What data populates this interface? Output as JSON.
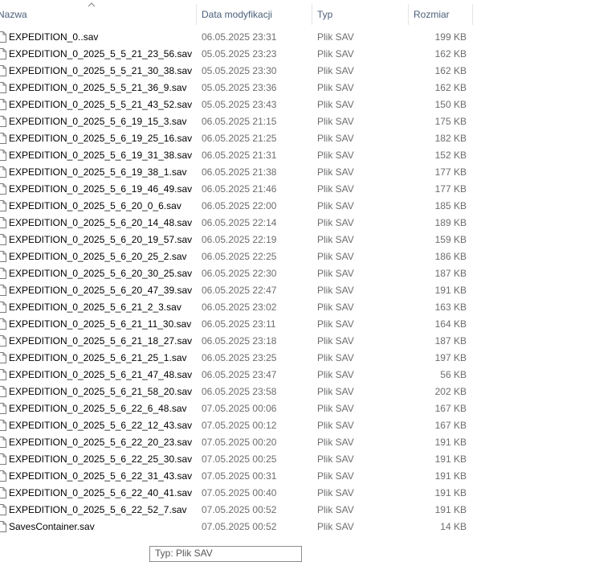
{
  "columns": {
    "name": "Nazwa",
    "date": "Data modyfikacji",
    "type": "Typ",
    "size": "Rozmiar"
  },
  "icons": {
    "sort": "sort-ascending-chevron-icon",
    "file": "file-icon"
  },
  "files": [
    {
      "name": "EXPEDITION_0..sav",
      "date": "06.05.2025 23:31",
      "type": "Plik SAV",
      "size": "199 KB"
    },
    {
      "name": "EXPEDITION_0_2025_5_5_21_23_56.sav",
      "date": "05.05.2025 23:23",
      "type": "Plik SAV",
      "size": "162 KB"
    },
    {
      "name": "EXPEDITION_0_2025_5_5_21_30_38.sav",
      "date": "05.05.2025 23:30",
      "type": "Plik SAV",
      "size": "162 KB"
    },
    {
      "name": "EXPEDITION_0_2025_5_5_21_36_9.sav",
      "date": "05.05.2025 23:36",
      "type": "Plik SAV",
      "size": "162 KB"
    },
    {
      "name": "EXPEDITION_0_2025_5_5_21_43_52.sav",
      "date": "05.05.2025 23:43",
      "type": "Plik SAV",
      "size": "150 KB"
    },
    {
      "name": "EXPEDITION_0_2025_5_6_19_15_3.sav",
      "date": "06.05.2025 21:15",
      "type": "Plik SAV",
      "size": "175 KB"
    },
    {
      "name": "EXPEDITION_0_2025_5_6_19_25_16.sav",
      "date": "06.05.2025 21:25",
      "type": "Plik SAV",
      "size": "182 KB"
    },
    {
      "name": "EXPEDITION_0_2025_5_6_19_31_38.sav",
      "date": "06.05.2025 21:31",
      "type": "Plik SAV",
      "size": "152 KB"
    },
    {
      "name": "EXPEDITION_0_2025_5_6_19_38_1.sav",
      "date": "06.05.2025 21:38",
      "type": "Plik SAV",
      "size": "177 KB"
    },
    {
      "name": "EXPEDITION_0_2025_5_6_19_46_49.sav",
      "date": "06.05.2025 21:46",
      "type": "Plik SAV",
      "size": "177 KB"
    },
    {
      "name": "EXPEDITION_0_2025_5_6_20_0_6.sav",
      "date": "06.05.2025 22:00",
      "type": "Plik SAV",
      "size": "185 KB"
    },
    {
      "name": "EXPEDITION_0_2025_5_6_20_14_48.sav",
      "date": "06.05.2025 22:14",
      "type": "Plik SAV",
      "size": "189 KB"
    },
    {
      "name": "EXPEDITION_0_2025_5_6_20_19_57.sav",
      "date": "06.05.2025 22:19",
      "type": "Plik SAV",
      "size": "159 KB"
    },
    {
      "name": "EXPEDITION_0_2025_5_6_20_25_2.sav",
      "date": "06.05.2025 22:25",
      "type": "Plik SAV",
      "size": "186 KB"
    },
    {
      "name": "EXPEDITION_0_2025_5_6_20_30_25.sav",
      "date": "06.05.2025 22:30",
      "type": "Plik SAV",
      "size": "187 KB"
    },
    {
      "name": "EXPEDITION_0_2025_5_6_20_47_39.sav",
      "date": "06.05.2025 22:47",
      "type": "Plik SAV",
      "size": "191 KB"
    },
    {
      "name": "EXPEDITION_0_2025_5_6_21_2_3.sav",
      "date": "06.05.2025 23:02",
      "type": "Plik SAV",
      "size": "163 KB"
    },
    {
      "name": "EXPEDITION_0_2025_5_6_21_11_30.sav",
      "date": "06.05.2025 23:11",
      "type": "Plik SAV",
      "size": "164 KB"
    },
    {
      "name": "EXPEDITION_0_2025_5_6_21_18_27.sav",
      "date": "06.05.2025 23:18",
      "type": "Plik SAV",
      "size": "187 KB"
    },
    {
      "name": "EXPEDITION_0_2025_5_6_21_25_1.sav",
      "date": "06.05.2025 23:25",
      "type": "Plik SAV",
      "size": "197 KB"
    },
    {
      "name": "EXPEDITION_0_2025_5_6_21_47_48.sav",
      "date": "06.05.2025 23:47",
      "type": "Plik SAV",
      "size": "56 KB"
    },
    {
      "name": "EXPEDITION_0_2025_5_6_21_58_20.sav",
      "date": "06.05.2025 23:58",
      "type": "Plik SAV",
      "size": "202 KB"
    },
    {
      "name": "EXPEDITION_0_2025_5_6_22_6_48.sav",
      "date": "07.05.2025 00:06",
      "type": "Plik SAV",
      "size": "167 KB"
    },
    {
      "name": "EXPEDITION_0_2025_5_6_22_12_43.sav",
      "date": "07.05.2025 00:12",
      "type": "Plik SAV",
      "size": "167 KB"
    },
    {
      "name": "EXPEDITION_0_2025_5_6_22_20_23.sav",
      "date": "07.05.2025 00:20",
      "type": "Plik SAV",
      "size": "191 KB"
    },
    {
      "name": "EXPEDITION_0_2025_5_6_22_25_30.sav",
      "date": "07.05.2025 00:25",
      "type": "Plik SAV",
      "size": "191 KB"
    },
    {
      "name": "EXPEDITION_0_2025_5_6_22_31_43.sav",
      "date": "07.05.2025 00:31",
      "type": "Plik SAV",
      "size": "191 KB"
    },
    {
      "name": "EXPEDITION_0_2025_5_6_22_40_41.sav",
      "date": "07.05.2025 00:40",
      "type": "Plik SAV",
      "size": "191 KB"
    },
    {
      "name": "EXPEDITION_0_2025_5_6_22_52_7.sav",
      "date": "07.05.2025 00:52",
      "type": "Plik SAV",
      "size": "191 KB"
    },
    {
      "name": "SavesContainer.sav",
      "date": "07.05.2025 00:52",
      "type": "Plik SAV",
      "size": "14 KB"
    }
  ],
  "tooltip": {
    "text": "Typ: Plik SAV"
  }
}
